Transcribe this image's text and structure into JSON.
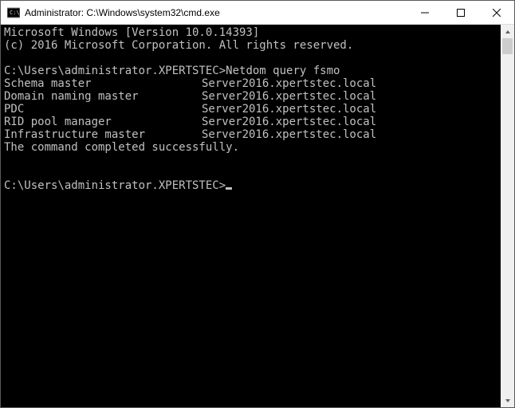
{
  "titlebar": {
    "title": "Administrator: C:\\Windows\\system32\\cmd.exe"
  },
  "console": {
    "banner_line1": "Microsoft Windows [Version 10.0.14393]",
    "banner_line2": "(c) 2016 Microsoft Corporation. All rights reserved.",
    "prompt1_path": "C:\\Users\\administrator.XPERTSTEC>",
    "prompt1_cmd": "Netdom query fsmo",
    "roles": [
      {
        "role": "Schema master",
        "value": "Server2016.xpertstec.local"
      },
      {
        "role": "Domain naming master",
        "value": "Server2016.xpertstec.local"
      },
      {
        "role": "PDC",
        "value": "Server2016.xpertstec.local"
      },
      {
        "role": "RID pool manager",
        "value": "Server2016.xpertstec.local"
      },
      {
        "role": "Infrastructure master",
        "value": "Server2016.xpertstec.local"
      }
    ],
    "completion_msg": "The command completed successfully.",
    "prompt2_path": "C:\\Users\\administrator.XPERTSTEC>"
  }
}
